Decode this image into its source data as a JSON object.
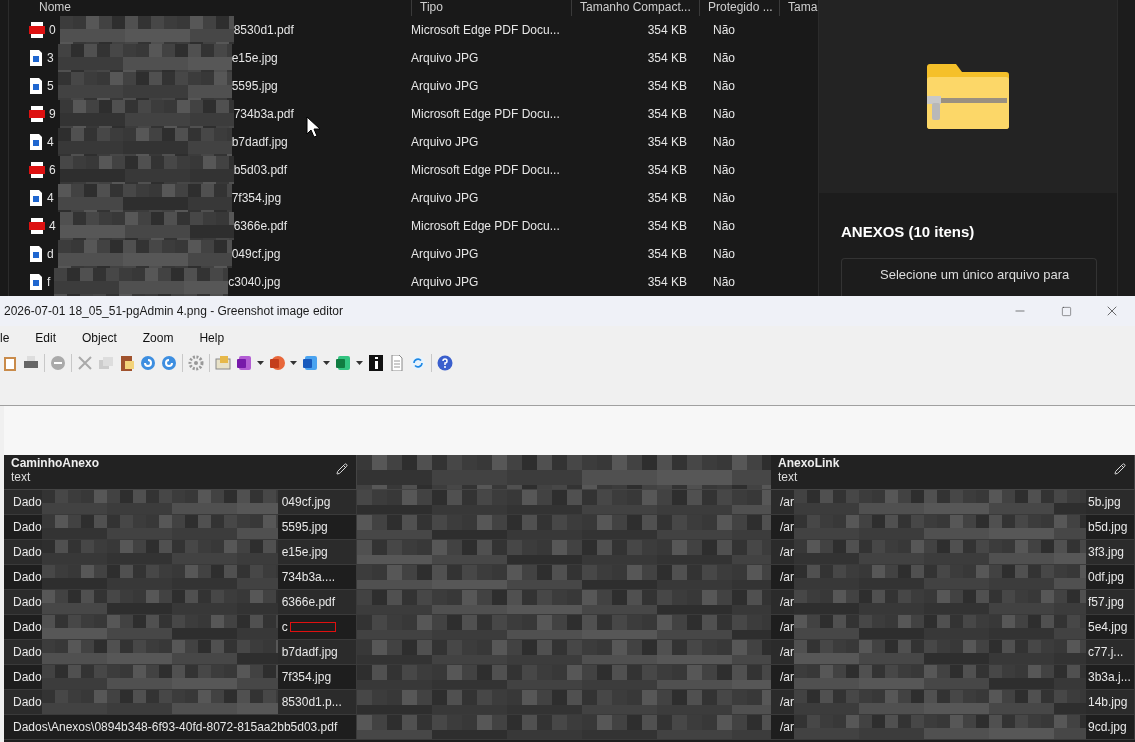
{
  "explorer": {
    "columns": [
      "Nome",
      "Tipo",
      "Tamanho Compact...",
      "Protegido ...",
      "Tama"
    ],
    "files": [
      {
        "kind": "pdf",
        "name_start": "0",
        "name_end": "8530d1.pdf",
        "type": "Microsoft Edge PDF Docu...",
        "size": "354 KB",
        "protected": "Não"
      },
      {
        "kind": "jpg",
        "name_start": "3",
        "name_end": "e15e.jpg",
        "type": "Arquivo JPG",
        "size": "354 KB",
        "protected": "Não"
      },
      {
        "kind": "jpg",
        "name_start": "5",
        "name_end": "5595.jpg",
        "type": "Arquivo JPG",
        "size": "354 KB",
        "protected": "Não"
      },
      {
        "kind": "pdf",
        "name_start": "9",
        "name_end": "734b3a.pdf",
        "type": "Microsoft Edge PDF Docu...",
        "size": "354 KB",
        "protected": "Não"
      },
      {
        "kind": "jpg",
        "name_start": "4",
        "name_end": "b7dadf.jpg",
        "type": "Arquivo JPG",
        "size": "354 KB",
        "protected": "Não"
      },
      {
        "kind": "pdf",
        "name_start": "6",
        "name_end": "b5d03.pdf",
        "type": "Microsoft Edge PDF Docu...",
        "size": "354 KB",
        "protected": "Não"
      },
      {
        "kind": "jpg",
        "name_start": "4",
        "name_end": "7f354.jpg",
        "type": "Arquivo JPG",
        "size": "354 KB",
        "protected": "Não"
      },
      {
        "kind": "pdf",
        "name_start": "4",
        "name_end": "6366e.pdf",
        "type": "Microsoft Edge PDF Docu...",
        "size": "354 KB",
        "protected": "Não"
      },
      {
        "kind": "jpg",
        "name_start": "d",
        "name_end": "049cf.jpg",
        "type": "Arquivo JPG",
        "size": "354 KB",
        "protected": "Não"
      },
      {
        "kind": "jpg",
        "name_start": "f",
        "name_end": "c3040.jpg",
        "type": "Arquivo JPG",
        "size": "354 KB",
        "protected": "Não"
      }
    ],
    "details": {
      "title": "ANEXOS (10 itens)",
      "message": "Selecione um único arquivo para"
    }
  },
  "editor": {
    "title": "2026-07-01 18_05_51-pgAdmin 4.png - Greenshot image editor",
    "menu": [
      "le",
      "Edit",
      "Object",
      "Zoom",
      "Help"
    ],
    "table": {
      "columns": [
        {
          "name": "CaminhoAnexo",
          "type": "text"
        },
        {
          "name": "AnexoLink",
          "type": "text"
        }
      ],
      "rows": [
        {
          "path_start": "Dado",
          "path_end": "049cf.jpg",
          "link_start": "/ar",
          "link_end": "5b.jpg"
        },
        {
          "path_start": "Dado",
          "path_end": "5595.jpg",
          "link_start": "/ar",
          "link_end": "b5d.jpg"
        },
        {
          "path_start": "Dado",
          "path_end": "e15e.jpg",
          "link_start": "/ar",
          "link_end": "3f3.jpg"
        },
        {
          "path_start": "Dado",
          "path_end": "734b3a....",
          "link_start": "/ar",
          "link_end": "0df.jpg"
        },
        {
          "path_start": "Dado",
          "path_end": "6366e.pdf",
          "link_start": "/ar",
          "link_end": "f57.jpg"
        },
        {
          "path_start": "Dado",
          "path_end": "c",
          "marked": true,
          "link_start": "/ar",
          "link_end": "5e4.jpg"
        },
        {
          "path_start": "Dado",
          "path_end": "b7dadf.jpg",
          "link_start": "/ar",
          "link_end": "c77.j..."
        },
        {
          "path_start": "Dado",
          "path_end": "7f354.jpg",
          "link_start": "/ar",
          "link_end": "3b3a.j..."
        },
        {
          "path_start": "Dado",
          "path_end": "8530d1.p...",
          "link_start": "/ar",
          "link_end": "14b.jpg"
        },
        {
          "path_start": "Dados\\Anexos\\0894b348-6f93-40fd-8072-815aa2bb5d03.pdf",
          "path_end": "",
          "link_start": "/ar",
          "link_end": "9cd.jpg"
        }
      ]
    }
  }
}
